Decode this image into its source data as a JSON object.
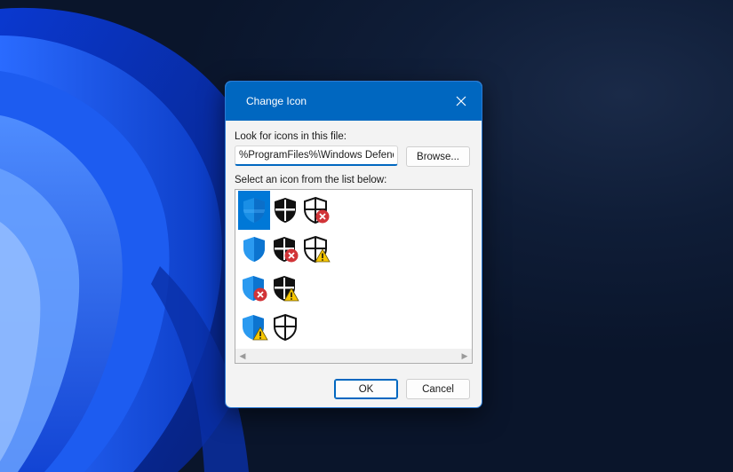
{
  "dialog": {
    "title": "Change Icon",
    "look_label": "Look for icons in this file:",
    "path_value": "%ProgramFiles%\\Windows Defender",
    "browse_label": "Browse...",
    "select_label": "Select an icon from the list below:",
    "ok_label": "OK",
    "cancel_label": "Cancel"
  },
  "icons": [
    {
      "name": "blue-shield-icon",
      "selected": true
    },
    {
      "name": "black-shield-icon"
    },
    {
      "name": "outline-shield-error-icon"
    },
    {
      "name": "blue-shield-icon"
    },
    {
      "name": "black-shield-error-icon"
    },
    {
      "name": "outline-shield-warning-icon"
    },
    {
      "name": "blue-shield-error-icon"
    },
    {
      "name": "black-shield-warning-icon"
    },
    {
      "name": "blue-shield-warning-icon"
    },
    {
      "name": "outline-shield-icon"
    }
  ],
  "colors": {
    "titlebar": "#0067c0",
    "selection": "#0078d7",
    "error_badge": "#d13438",
    "warning_badge": "#f7c700"
  }
}
